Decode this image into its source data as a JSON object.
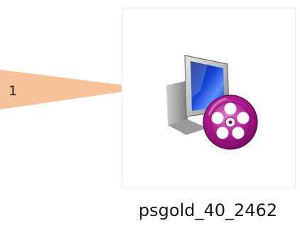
{
  "callout": {
    "label": "1",
    "color": "#f7c199"
  },
  "file": {
    "name": "psgold_40_2462",
    "icon": "installer-monitor-disc-icon"
  }
}
